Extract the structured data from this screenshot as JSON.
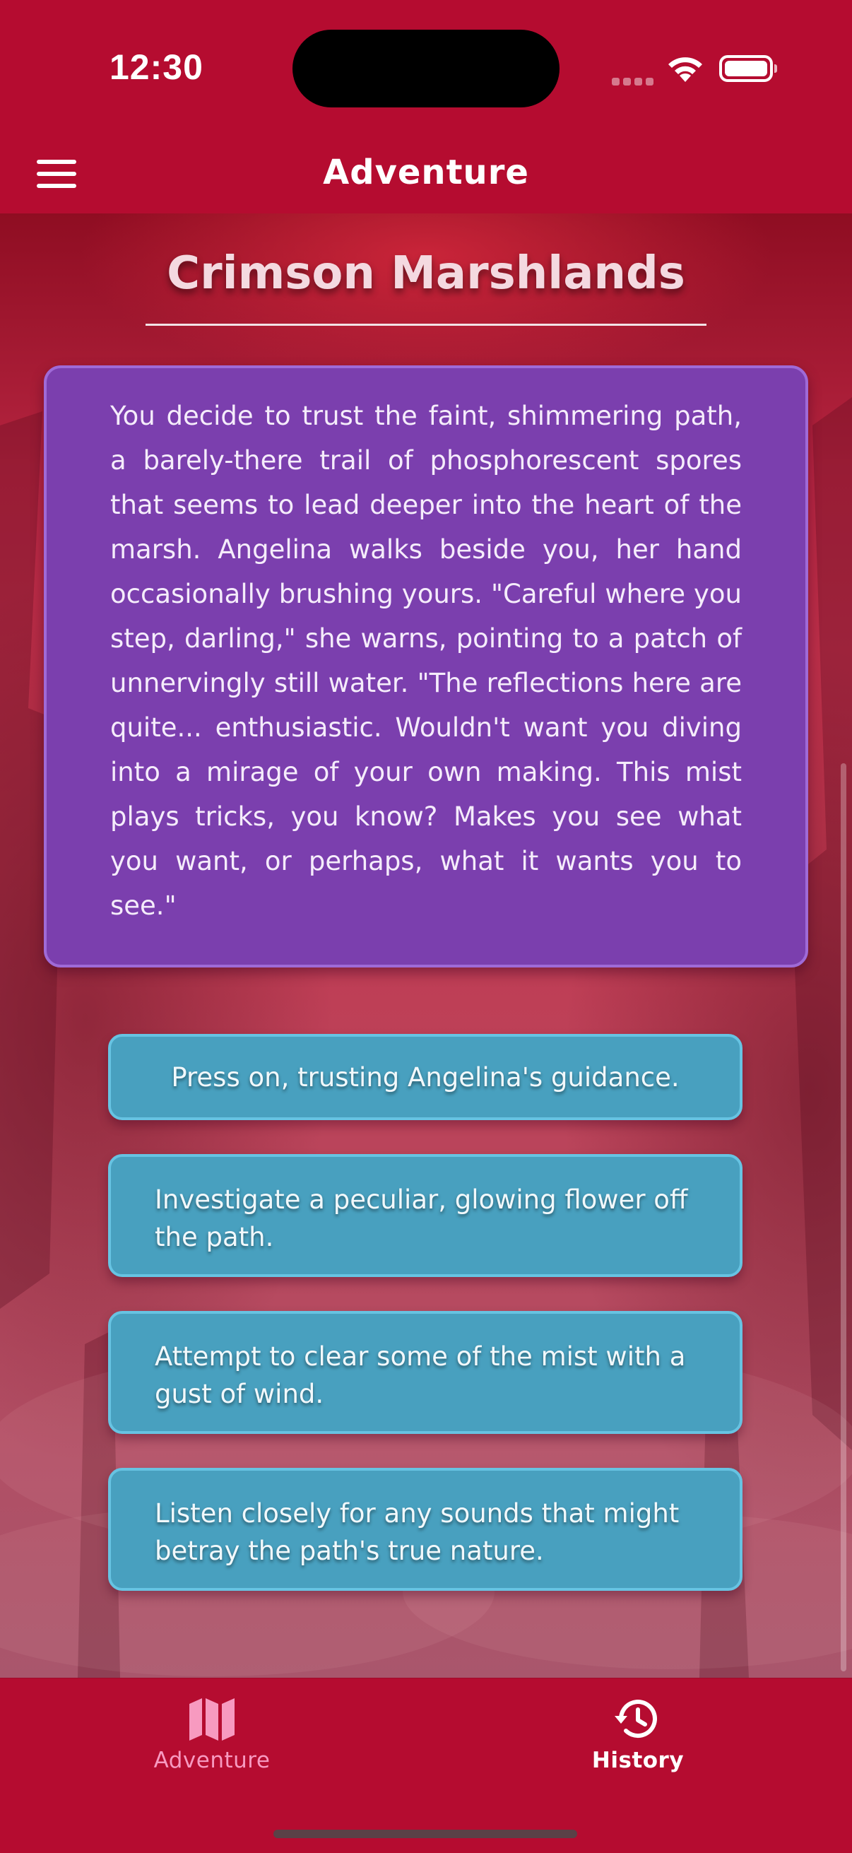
{
  "status_bar": {
    "time": "12:30"
  },
  "header": {
    "title": "Adventure"
  },
  "location": {
    "name": "Crimson Marshlands"
  },
  "story": {
    "text": "You decide to trust the faint, shimmering path, a barely-there trail of phosphorescent spores that seems to lead deeper into the heart of the marsh. Angelina walks beside you, her hand occasionally brushing yours. \"Careful where you step, darling,\" she warns, pointing to a patch of unnervingly still water. \"The reflections here are quite... enthusiastic. Wouldn't want you diving into a mirage of your own making. This mist plays tricks, you know? Makes you see what you want, or perhaps, what it wants you to see.\""
  },
  "choices": [
    {
      "label": "Press on, trusting Angelina's guidance."
    },
    {
      "label": "Investigate a peculiar, glowing flower off the path."
    },
    {
      "label": "Attempt to clear some of the mist with a gust of wind."
    },
    {
      "label": "Listen closely for any sounds that might betray the path's true nature."
    }
  ],
  "tab_bar": {
    "tabs": [
      {
        "label": "Adventure",
        "icon": "map-icon",
        "selected": true
      },
      {
        "label": "History",
        "icon": "history-icon",
        "selected": false
      }
    ]
  },
  "colors": {
    "primary": "#b50c30",
    "story_card": "#7b3fae",
    "choice_button": "#48a0bf",
    "tab_active": "#f79ac0"
  }
}
